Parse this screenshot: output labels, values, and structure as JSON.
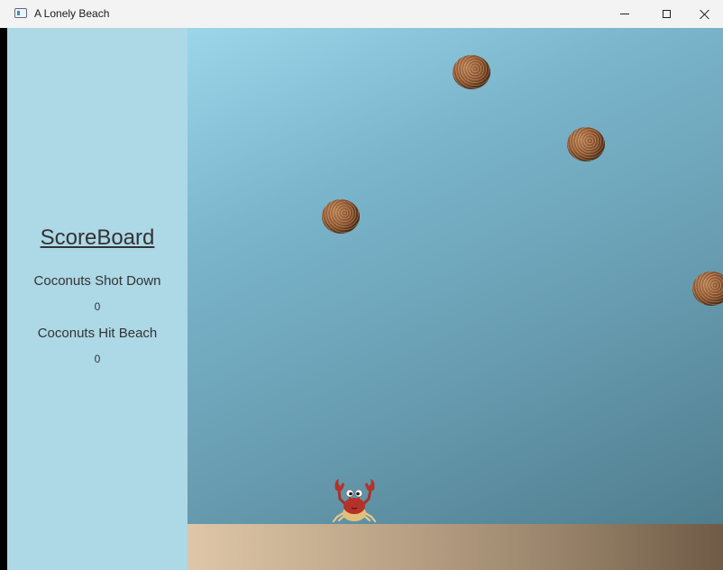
{
  "window": {
    "title": "A Lonely Beach"
  },
  "scoreboard": {
    "title": "ScoreBoard",
    "shot_down_label": "Coconuts Shot Down",
    "shot_down_value": "0",
    "hit_beach_label": "Coconuts Hit Beach",
    "hit_beach_value": "0"
  },
  "colors": {
    "sidebar": "#add8e6",
    "sky_top": "#9bd6ea",
    "sky_bottom": "#4f7d8e",
    "sand_light": "#dfc6a8",
    "sand_dark": "#6f5b46",
    "crab": "#b3322a"
  },
  "icons": {
    "app": "window-app-icon",
    "minimize": "minimize-icon",
    "maximize": "maximize-icon",
    "close": "close-icon",
    "coconut": "coconut-icon",
    "crab": "crab-icon"
  }
}
